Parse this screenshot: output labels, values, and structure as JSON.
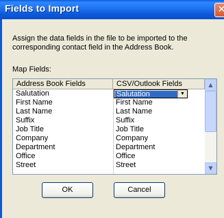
{
  "window": {
    "title": "Fields to Import",
    "close_glyph": "✕"
  },
  "description": "Assign the data fields in the file to be imported to the corresponding contact field in the Address Book.",
  "map_label": "Map Fields:",
  "table": {
    "headers": [
      "Address Book Fields",
      "CSV/Outlook Fields"
    ],
    "rows": [
      [
        "Salutation",
        "Salutation"
      ],
      [
        "First Name",
        "First Name"
      ],
      [
        "Last Name",
        "Last Name"
      ],
      [
        "Suffix",
        "Suffix"
      ],
      [
        "Job Title",
        "Job Title"
      ],
      [
        "Company",
        "Company"
      ],
      [
        "Department",
        "Department"
      ],
      [
        "Office",
        "Office"
      ],
      [
        "Street",
        "Street"
      ]
    ],
    "dropdown_value": "Salutation"
  },
  "buttons": {
    "ok": "OK",
    "cancel": "Cancel"
  },
  "colors": {
    "titlebar": "#0a5fdc",
    "selection": "#316ac5",
    "dialog_bg": "#ece9d8"
  },
  "icons": {
    "close": "close-icon",
    "scroll_up": "scroll-up-icon",
    "scroll_down": "scroll-down-icon",
    "dropdown": "chevron-down-icon"
  }
}
